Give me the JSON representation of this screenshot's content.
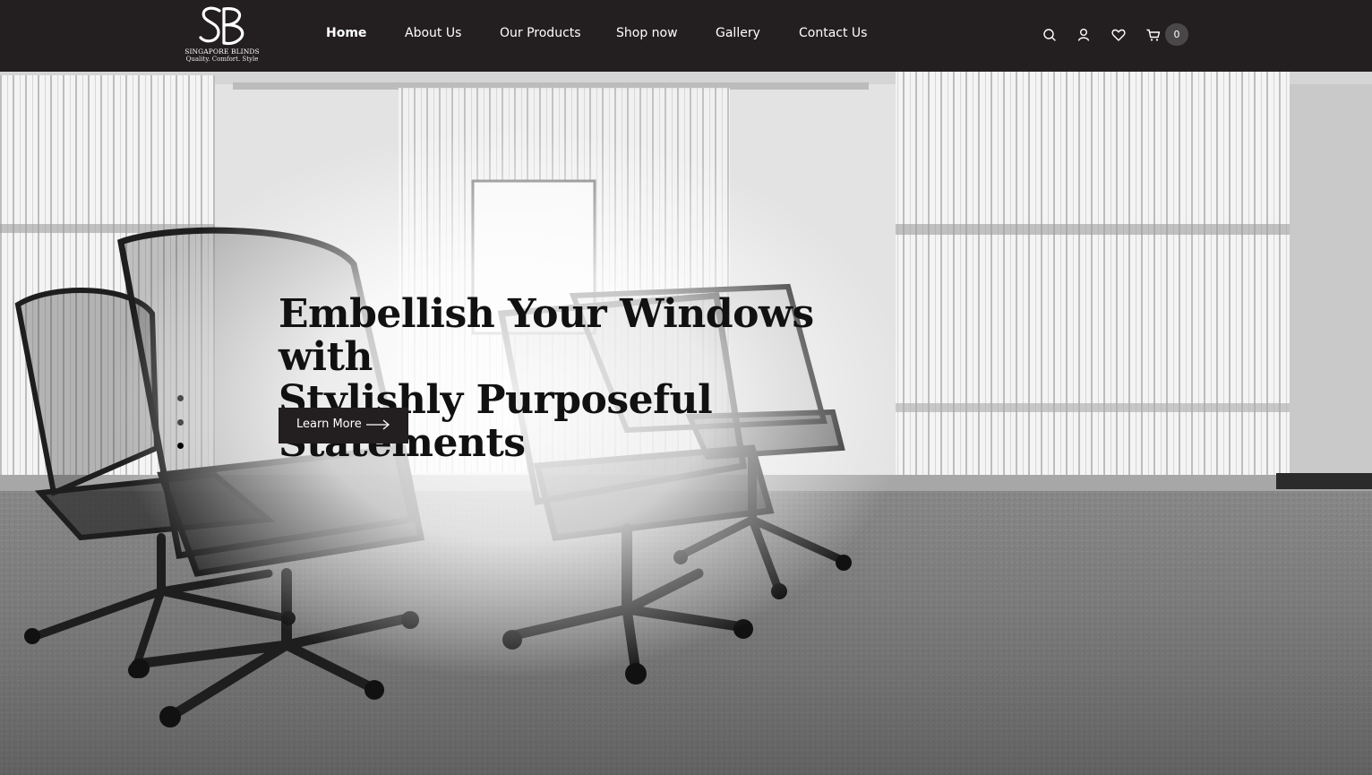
{
  "brand": {
    "monogram": "SB",
    "name": "SINGAPORE BLINDS",
    "tagline": "Quality. Comfort. Style"
  },
  "nav": {
    "items": [
      {
        "label": "Home",
        "active": true
      },
      {
        "label": "About Us"
      },
      {
        "label": "Our Products"
      },
      {
        "label": "Shop now"
      },
      {
        "label": "Gallery"
      },
      {
        "label": "Contact Us"
      }
    ]
  },
  "header_icons": [
    "search-icon",
    "user-icon",
    "heart-icon",
    "cart-icon"
  ],
  "cart": {
    "count": "0"
  },
  "hero": {
    "title_line1": "Embellish Your Windows with",
    "title_line2": "Stylishly Purposeful Statements",
    "cta_label": "Learn More",
    "slides_total": 3,
    "active_slide": 3
  },
  "colors": {
    "header_bg": "#231f20",
    "button_bg": "#231f20",
    "badge_bg": "#4a4748",
    "text_light": "#ffffff",
    "title_text": "#111111"
  }
}
